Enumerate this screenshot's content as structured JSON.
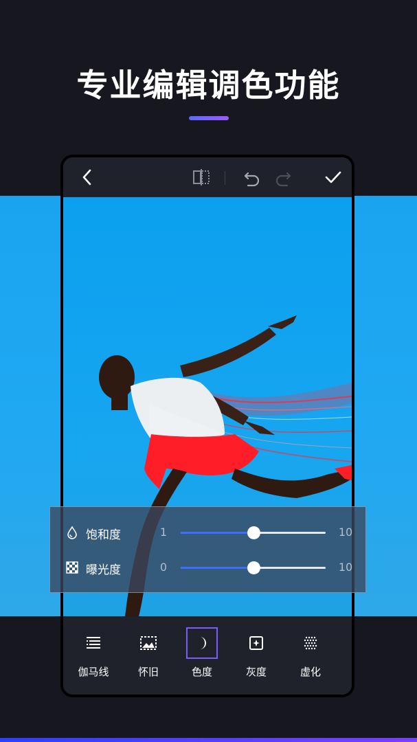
{
  "headline": "专业编辑调色功能",
  "colors": {
    "accent": "#7c5cff",
    "slider_fill": "#3d6cff",
    "photo_bg": "#16a5f0",
    "shorts": "#ff1e28"
  },
  "topbar": {
    "icons": [
      "back-icon",
      "compare-icon",
      "undo-icon",
      "redo-icon",
      "confirm-icon"
    ]
  },
  "adjustments": [
    {
      "label": "饱和度",
      "icon": "droplet-icon",
      "min": "1",
      "max": "10",
      "level": 0.5
    },
    {
      "label": "曝光度",
      "icon": "checker-icon",
      "min": "0",
      "max": "10",
      "level": 0.5
    }
  ],
  "tools": [
    {
      "label": "伽马线",
      "icon": "gamma-icon",
      "active": false
    },
    {
      "label": "怀旧",
      "icon": "vintage-icon",
      "active": false
    },
    {
      "label": "色度",
      "icon": "moon-icon",
      "active": true
    },
    {
      "label": "灰度",
      "icon": "grayscale-icon",
      "active": false
    },
    {
      "label": "虚化",
      "icon": "blur-icon",
      "active": false
    }
  ]
}
